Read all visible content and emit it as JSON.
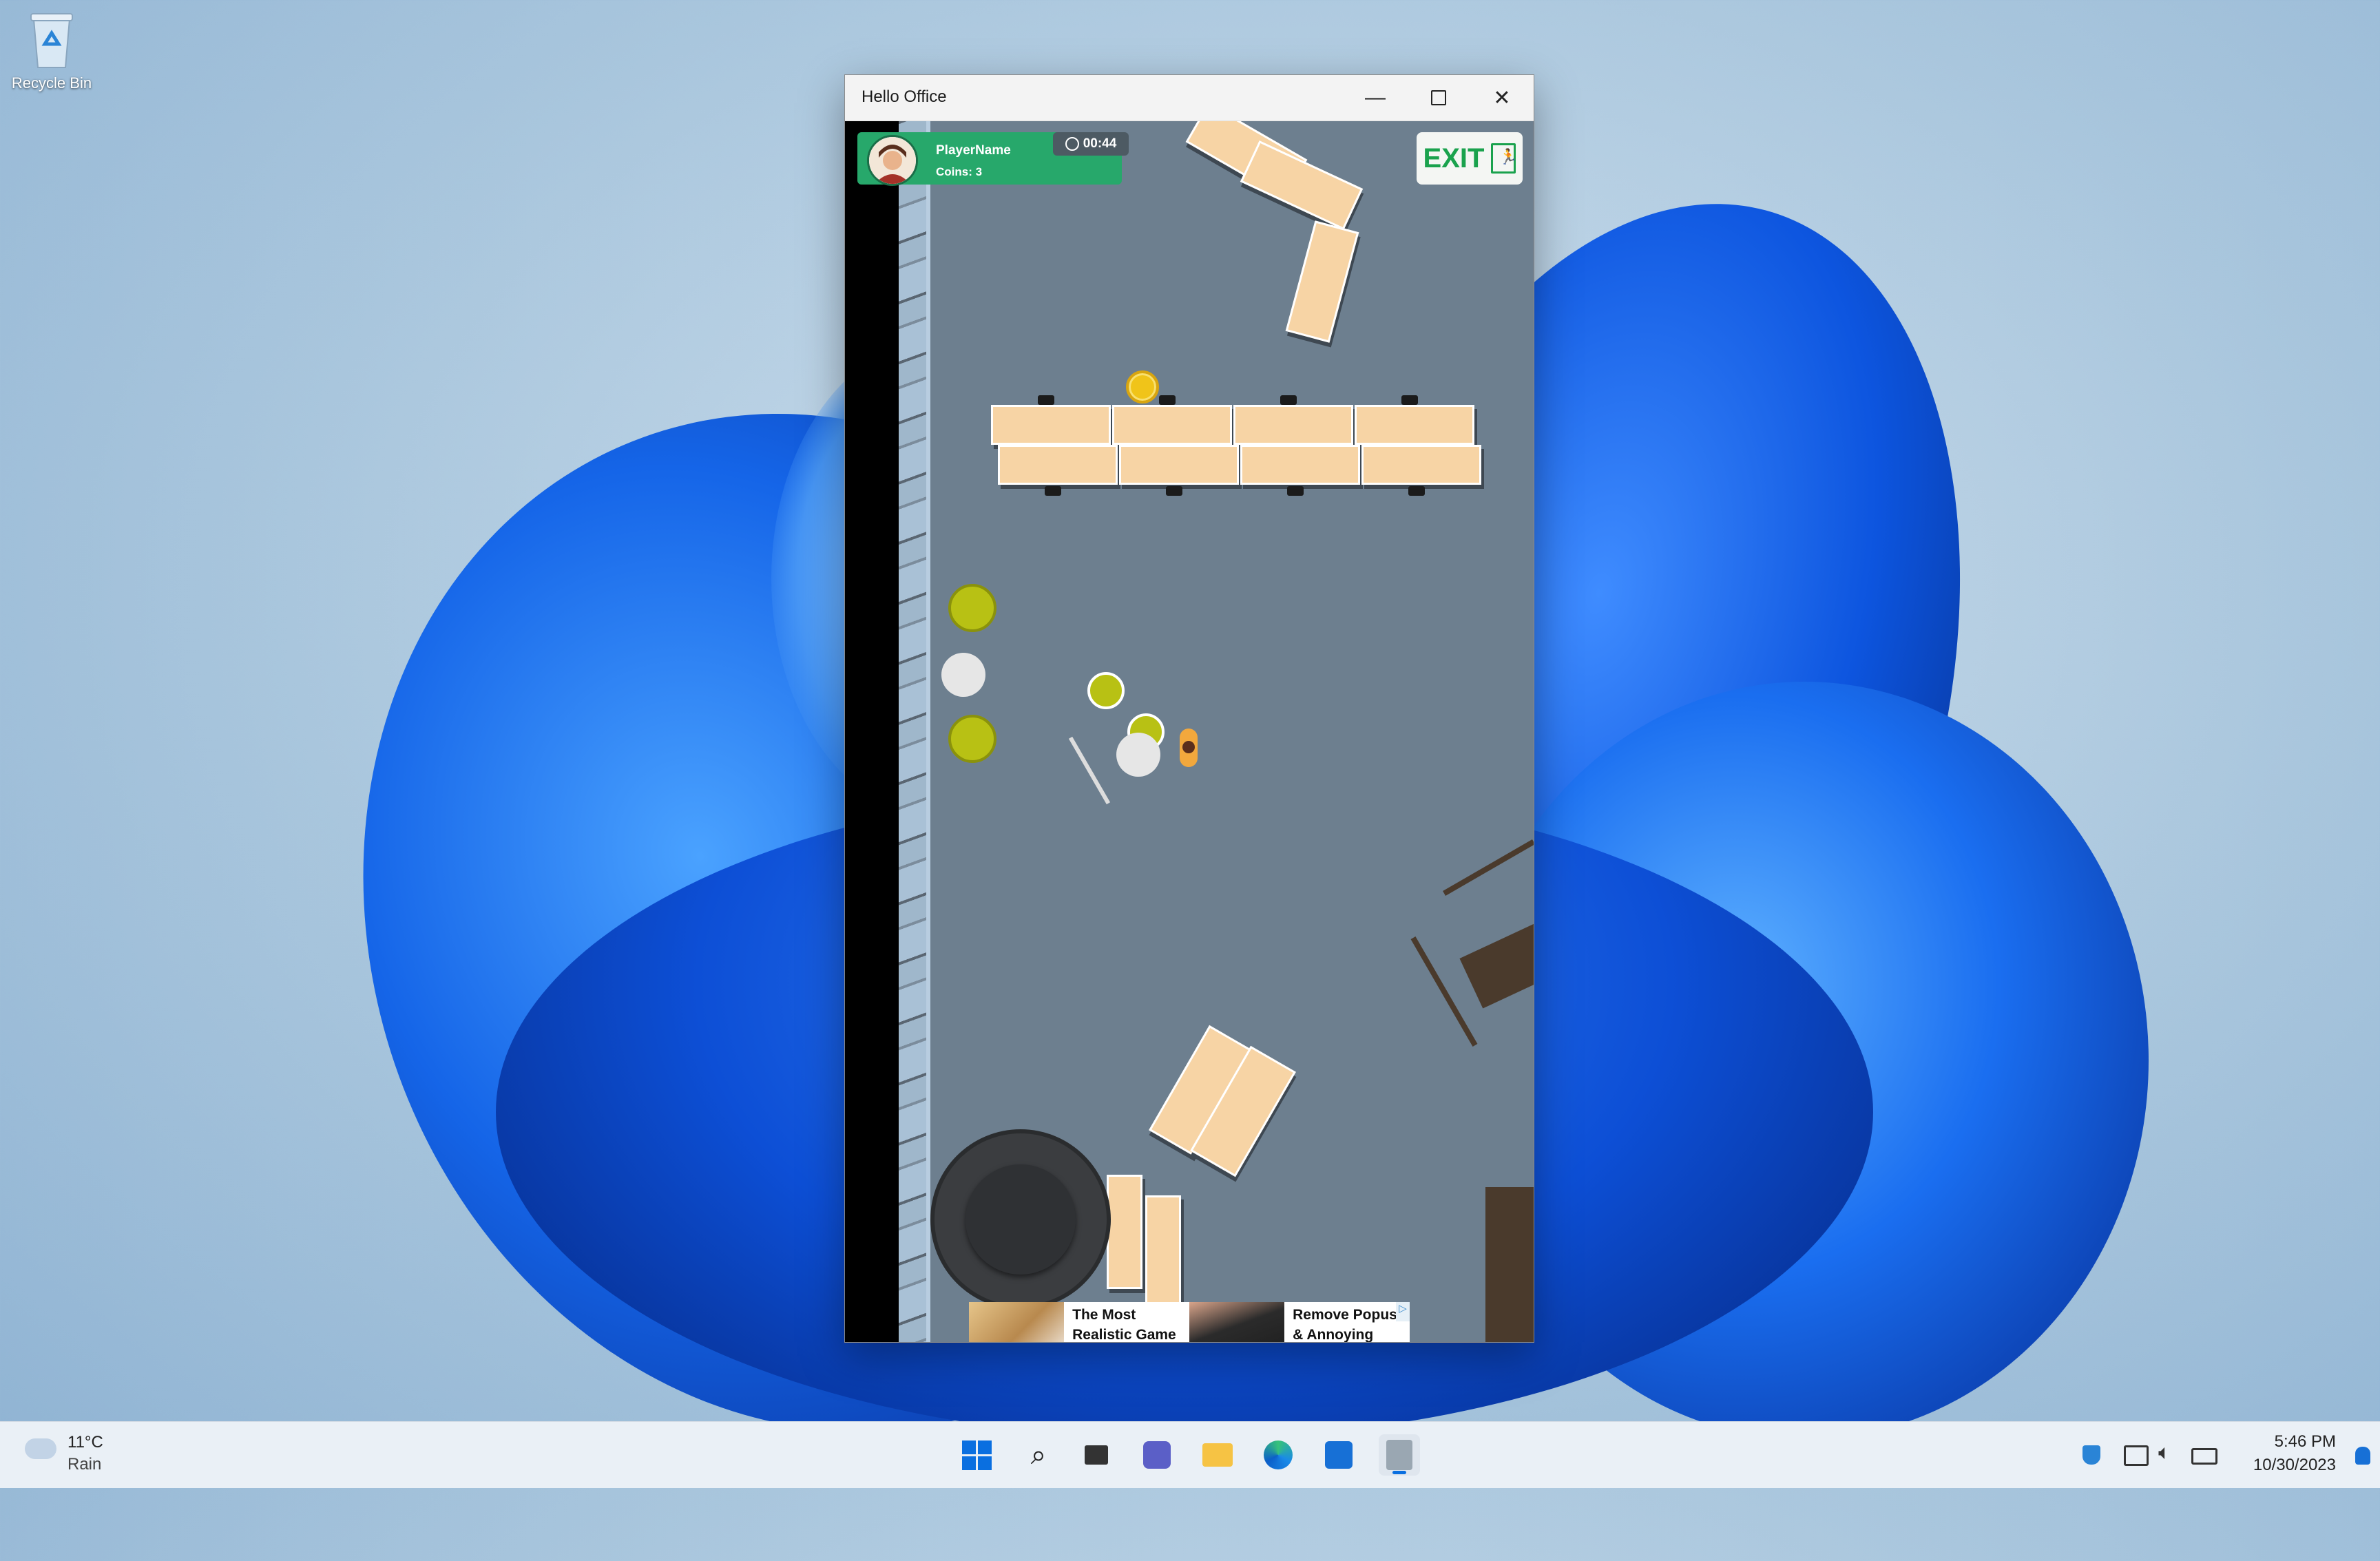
{
  "desktop": {
    "icons": [
      {
        "label": "Recycle Bin",
        "icon": "recycle-bin-icon"
      }
    ]
  },
  "window": {
    "title": "Hello Office",
    "controls": {
      "minimize": "minimize-icon",
      "maximize": "maximize-icon",
      "close": "close-icon"
    }
  },
  "game": {
    "hud": {
      "player_name": "PlayerName",
      "coins": "Coins: 3",
      "timer": "00:44"
    },
    "exit_label": "EXIT",
    "ad": {
      "left_text": "The Most Realistic Game of",
      "right_text": "Remove Popus & Annoying",
      "adchoices": "▷"
    }
  },
  "taskbar": {
    "weather": {
      "temp": "11°C",
      "condition": "Rain"
    },
    "apps": [
      "start-icon",
      "search-icon",
      "task-view-icon",
      "teams-icon",
      "file-explorer-icon",
      "edge-icon",
      "store-icon",
      "hello-office-icon"
    ],
    "clock": {
      "time": "5:46 PM",
      "date": "10/30/2023"
    }
  },
  "colors": {
    "hud_green": "#27a86b",
    "exit_green": "#1aa24d",
    "floor": "#6d7f8f",
    "desk": "#f7d4a5"
  }
}
